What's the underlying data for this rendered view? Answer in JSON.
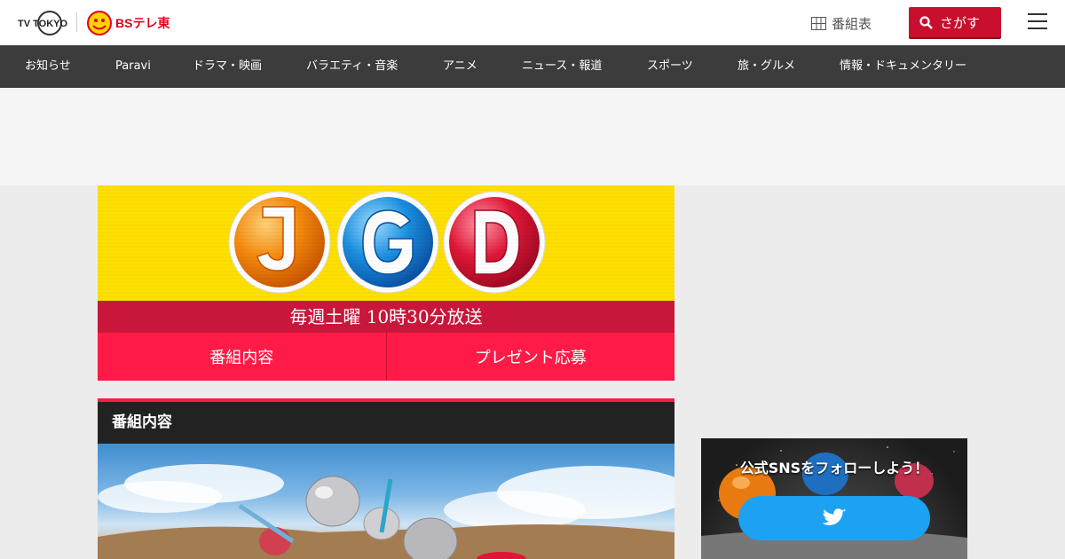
{
  "header": {
    "logo_tvtokyo": "TV TOKYO",
    "logo_bs": "BSテレ東",
    "bangumi_label": "番組表",
    "search_label": "さがす"
  },
  "nav": {
    "items": [
      {
        "label": "お知らせ"
      },
      {
        "label": "Paravi"
      },
      {
        "label": "ドラマ・映画"
      },
      {
        "label": "バラエティ・音楽"
      },
      {
        "label": "アニメ"
      },
      {
        "label": "ニュース・報道"
      },
      {
        "label": "スポーツ"
      },
      {
        "label": "旅・グルメ"
      },
      {
        "label": "情報・ドキュメンタリー"
      }
    ]
  },
  "program": {
    "logo_letters": [
      "J",
      "G",
      "D"
    ],
    "broadcast_time": "毎週土曜 10時30分放送",
    "tabs": [
      {
        "label": "番組内容"
      },
      {
        "label": "プレゼント応募"
      }
    ],
    "section_title": "番組内容"
  },
  "sidebar": {
    "sns_title": "公式SNSをフォローしよう！",
    "twitter_icon": "twitter-bird-icon"
  },
  "colors": {
    "brand_red": "#c8102e",
    "tab_pink": "#ff1a47",
    "hero_yellow": "#ffe000",
    "nav_dark": "#3c3c3c",
    "twitter_blue": "#1da1f2"
  }
}
